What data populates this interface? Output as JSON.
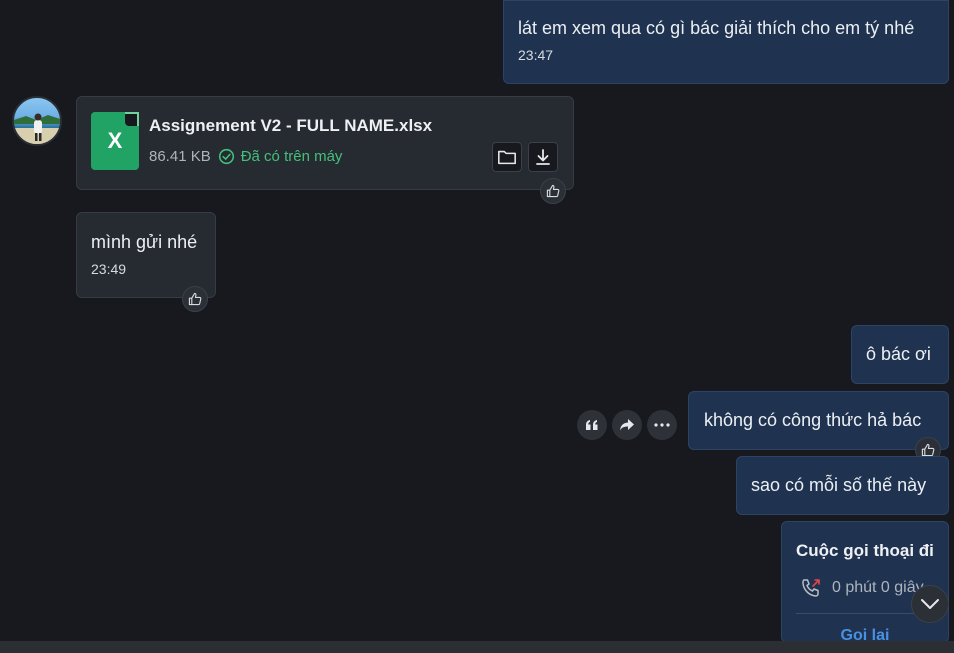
{
  "messages": {
    "m1": {
      "text": "lát em xem qua có gì bác giải thích cho em tý nhé",
      "time": "23:47"
    },
    "file": {
      "name": "Assignement V2 - FULL NAME.xlsx",
      "size": "86.41 KB",
      "status": "Đã có trên máy",
      "icon_letter": "X"
    },
    "m2": {
      "text": "mình gửi nhé",
      "time": "23:49"
    },
    "m3": {
      "text": "ô bác ơi"
    },
    "m4": {
      "text": "không có công thức hả bác"
    },
    "m5": {
      "text": "sao có mỗi số thế này"
    },
    "call": {
      "title": "Cuộc gọi thoại đi",
      "duration": "0 phút 0 giây",
      "action": "Gọi lại"
    }
  },
  "colors": {
    "background": "#17191e",
    "outgoing_bubble": "#1f3350",
    "incoming_bubble": "#262a31",
    "success_green": "#43c07a",
    "excel_green": "#21a366",
    "link_blue": "#4a90e2",
    "missed_red": "#e64545"
  },
  "icons": [
    "thumbs-up-icon",
    "folder-icon",
    "download-icon",
    "check-circle-icon",
    "quote-icon",
    "forward-icon",
    "more-icon",
    "phone-icon",
    "chevron-down-icon"
  ]
}
